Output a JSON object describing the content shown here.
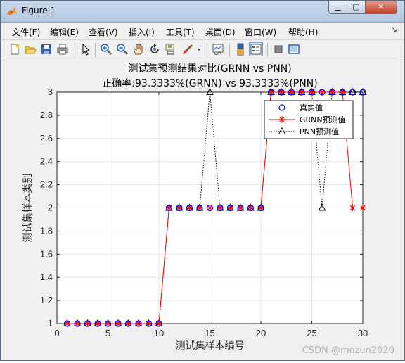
{
  "window": {
    "title": "Figure 1"
  },
  "window_buttons": {
    "minimize": "▁",
    "maximize": "▢",
    "close": "✕"
  },
  "menu": [
    {
      "id": "file",
      "label": "文件(F)"
    },
    {
      "id": "edit",
      "label": "编辑(E)"
    },
    {
      "id": "view",
      "label": "查看(V)"
    },
    {
      "id": "insert",
      "label": "插入(I)"
    },
    {
      "id": "tools",
      "label": "工具(T)"
    },
    {
      "id": "desktop",
      "label": "桌面(D)"
    },
    {
      "id": "window",
      "label": "窗口(W)"
    },
    {
      "id": "help",
      "label": "帮助(H)"
    }
  ],
  "toolbar_icons": [
    "new-figure-icon",
    "open-file-icon",
    "save-icon",
    "print-icon",
    "edit-plot-arrow-icon",
    "zoom-in-icon",
    "zoom-out-icon",
    "pan-hand-icon",
    "rotate-3d-icon",
    "data-cursor-icon",
    "brush-icon",
    "dropdown-arrow-icon",
    "link-plot-icon",
    "colorbar-icon",
    "legend-icon",
    "hide-plot-tools-icon",
    "show-plot-tools-icon"
  ],
  "watermark": "CSDN @mozun2020",
  "colors": {
    "true": "#0000ff",
    "grnn": "#ff0000",
    "pnn": "#000000",
    "plot_bg": "#ffffff",
    "grid": "#e6e6e6"
  },
  "chart_data": {
    "type": "line",
    "title": "测试集预测结果对比(GRNN vs PNN)",
    "subtitle": "正确率:93.3333%(GRNN) vs 93.3333%(PNN)",
    "xlabel": "测试集样本编号",
    "ylabel": "测试集样本类别",
    "xlim": [
      0,
      30
    ],
    "ylim": [
      1,
      3
    ],
    "xticks": [
      0,
      5,
      10,
      15,
      20,
      25,
      30
    ],
    "yticks": [
      1,
      1.2,
      1.4,
      1.6,
      1.8,
      2,
      2.2,
      2.4,
      2.6,
      2.8,
      3
    ],
    "grid": true,
    "legend_position": "top-right",
    "x": [
      1,
      2,
      3,
      4,
      5,
      6,
      7,
      8,
      9,
      10,
      11,
      12,
      13,
      14,
      15,
      16,
      17,
      18,
      19,
      20,
      21,
      22,
      23,
      24,
      25,
      26,
      27,
      28,
      29,
      30
    ],
    "series": [
      {
        "name": "真实值",
        "marker": "circle",
        "line": "none",
        "color": "#0000ff",
        "values": [
          1,
          1,
          1,
          1,
          1,
          1,
          1,
          1,
          1,
          1,
          2,
          2,
          2,
          2,
          2,
          2,
          2,
          2,
          2,
          2,
          3,
          3,
          3,
          3,
          3,
          3,
          3,
          3,
          3,
          3
        ]
      },
      {
        "name": "GRNN预测值",
        "marker": "star",
        "line": "solid",
        "color": "#ff0000",
        "values": [
          1,
          1,
          1,
          1,
          1,
          1,
          1,
          1,
          1,
          1,
          2,
          2,
          2,
          2,
          2,
          2,
          2,
          2,
          2,
          2,
          3,
          3,
          3,
          3,
          3,
          3,
          3,
          3,
          2,
          2
        ]
      },
      {
        "name": "PNN预测值",
        "marker": "triangle",
        "line": "dotted",
        "color": "#000000",
        "values": [
          1,
          1,
          1,
          1,
          1,
          1,
          1,
          1,
          1,
          1,
          2,
          2,
          2,
          2,
          3,
          2,
          2,
          2,
          2,
          2,
          3,
          3,
          3,
          3,
          3,
          2,
          3,
          3,
          3,
          3
        ]
      }
    ]
  }
}
